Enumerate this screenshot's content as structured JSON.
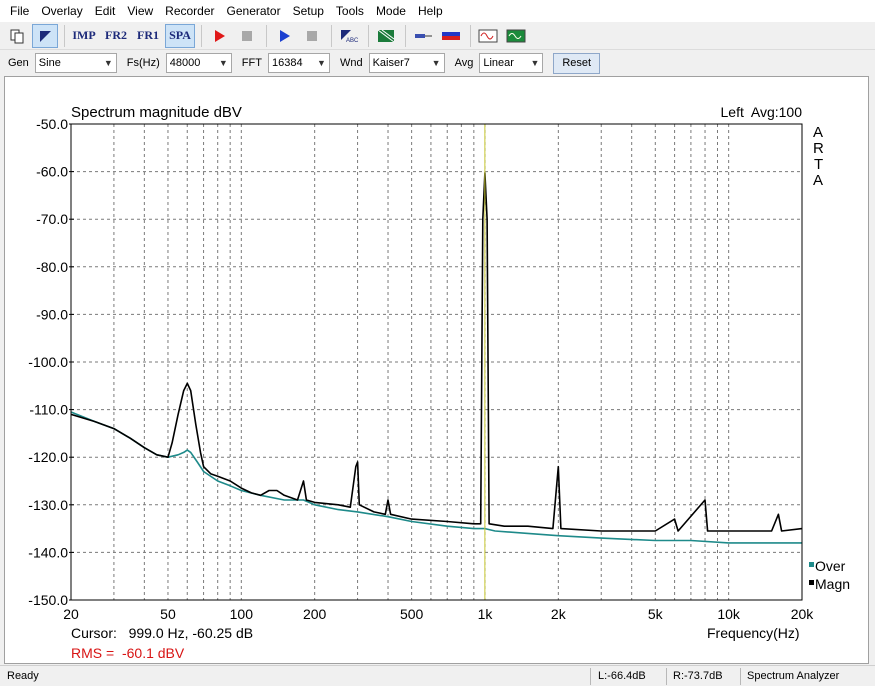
{
  "menu": [
    "File",
    "Overlay",
    "Edit",
    "View",
    "Recorder",
    "Generator",
    "Setup",
    "Tools",
    "Mode",
    "Help"
  ],
  "toolbar": {
    "imp_label": "IMP",
    "fr2_label": "FR2",
    "fr1_label": "FR1",
    "spa_label": "SPA"
  },
  "settings": {
    "gen_label": "Gen",
    "gen_value": "Sine",
    "fs_label": "Fs(Hz)",
    "fs_value": "48000",
    "fft_label": "FFT",
    "fft_value": "16384",
    "wnd_label": "Wnd",
    "wnd_value": "Kaiser7",
    "avg_label": "Avg",
    "avg_value": "Linear",
    "reset_label": "Reset"
  },
  "plot": {
    "channel_info": "Left  Avg:100",
    "arta_letters": [
      "A",
      "R",
      "T",
      "A"
    ],
    "cursor_text": "Cursor:   999.0 Hz, -60.25 dB",
    "rms_text": "RMS =  -60.1 dBV",
    "colors": {
      "magn": "#000000",
      "over": "#1e8a8a",
      "cursor": "#c8c832",
      "rms": "#d81414",
      "grid": "#7a7a7a"
    }
  },
  "chart_data": {
    "type": "line",
    "title": "Spectrum magnitude dBV",
    "xlabel": "Frequency(Hz)",
    "ylabel": "",
    "x_scale": "log",
    "xlim": [
      20,
      20000
    ],
    "ylim": [
      -150,
      -50
    ],
    "grid": true,
    "legend_position": "bottom-right",
    "x_tick_labels": [
      {
        "value": 20,
        "label": "20"
      },
      {
        "value": 50,
        "label": "50"
      },
      {
        "value": 100,
        "label": "100"
      },
      {
        "value": 200,
        "label": "200"
      },
      {
        "value": 500,
        "label": "500"
      },
      {
        "value": 1000,
        "label": "1k"
      },
      {
        "value": 2000,
        "label": "2k"
      },
      {
        "value": 5000,
        "label": "5k"
      },
      {
        "value": 10000,
        "label": "10k"
      },
      {
        "value": 20000,
        "label": "20k"
      }
    ],
    "y_ticks": [
      -50,
      -60,
      -70,
      -80,
      -90,
      -100,
      -110,
      -120,
      -130,
      -140,
      -150
    ],
    "y_tick_labels": [
      "-50.0",
      "-60.0",
      "-70.0",
      "-80.0",
      "-90.0",
      "-100.0",
      "-110.0",
      "-120.0",
      "-130.0",
      "-140.0",
      "-150.0"
    ],
    "cursor_x": 999,
    "series": [
      {
        "name": "Over",
        "color": "#1e8a8a",
        "points": [
          [
            20,
            -110.5
          ],
          [
            25,
            -112.5
          ],
          [
            30,
            -114
          ],
          [
            35,
            -116
          ],
          [
            40,
            -118
          ],
          [
            45,
            -119.5
          ],
          [
            50,
            -120
          ],
          [
            55,
            -119.5
          ],
          [
            58,
            -119
          ],
          [
            60,
            -118.5
          ],
          [
            62,
            -119
          ],
          [
            66,
            -121
          ],
          [
            70,
            -123
          ],
          [
            80,
            -125
          ],
          [
            90,
            -126
          ],
          [
            100,
            -127
          ],
          [
            120,
            -128
          ],
          [
            150,
            -129
          ],
          [
            180,
            -129
          ],
          [
            200,
            -130
          ],
          [
            250,
            -131
          ],
          [
            300,
            -131.5
          ],
          [
            400,
            -132.5
          ],
          [
            500,
            -133.5
          ],
          [
            700,
            -134.5
          ],
          [
            900,
            -135
          ],
          [
            1000,
            -135
          ],
          [
            1100,
            -135.5
          ],
          [
            1500,
            -136
          ],
          [
            2000,
            -136.5
          ],
          [
            3000,
            -137
          ],
          [
            5000,
            -137.5
          ],
          [
            7000,
            -137.5
          ],
          [
            10000,
            -138
          ],
          [
            15000,
            -138
          ],
          [
            20000,
            -138
          ]
        ]
      },
      {
        "name": "Magn",
        "color": "#000000",
        "points": [
          [
            20,
            -111
          ],
          [
            25,
            -112.5
          ],
          [
            30,
            -114
          ],
          [
            35,
            -116
          ],
          [
            40,
            -118
          ],
          [
            45,
            -119.5
          ],
          [
            50,
            -120
          ],
          [
            52,
            -117
          ],
          [
            55,
            -111
          ],
          [
            58,
            -106
          ],
          [
            60,
            -104.5
          ],
          [
            62,
            -106
          ],
          [
            65,
            -113
          ],
          [
            68,
            -119
          ],
          [
            70,
            -122
          ],
          [
            75,
            -123.5
          ],
          [
            80,
            -124
          ],
          [
            90,
            -125
          ],
          [
            100,
            -126.5
          ],
          [
            110,
            -127.5
          ],
          [
            120,
            -128
          ],
          [
            130,
            -127
          ],
          [
            140,
            -127
          ],
          [
            150,
            -128
          ],
          [
            170,
            -129
          ],
          [
            180,
            -125
          ],
          [
            185,
            -129
          ],
          [
            200,
            -129.5
          ],
          [
            250,
            -130
          ],
          [
            280,
            -130.5
          ],
          [
            295,
            -122
          ],
          [
            300,
            -121
          ],
          [
            305,
            -130
          ],
          [
            350,
            -131.5
          ],
          [
            390,
            -132
          ],
          [
            400,
            -129
          ],
          [
            410,
            -132
          ],
          [
            500,
            -133
          ],
          [
            700,
            -133.5
          ],
          [
            900,
            -134
          ],
          [
            960,
            -134
          ],
          [
            980,
            -70
          ],
          [
            999,
            -60.25
          ],
          [
            1020,
            -70
          ],
          [
            1040,
            -134
          ],
          [
            1200,
            -134.5
          ],
          [
            1500,
            -134.5
          ],
          [
            1900,
            -135
          ],
          [
            2000,
            -122
          ],
          [
            2050,
            -135
          ],
          [
            3000,
            -135.5
          ],
          [
            5000,
            -135.5
          ],
          [
            6000,
            -133
          ],
          [
            6200,
            -135.5
          ],
          [
            8000,
            -129
          ],
          [
            8200,
            -135.5
          ],
          [
            10000,
            -135.5
          ],
          [
            15000,
            -135.5
          ],
          [
            16000,
            -132
          ],
          [
            16500,
            -135.5
          ],
          [
            20000,
            -135
          ]
        ]
      }
    ]
  },
  "status": {
    "ready": "Ready",
    "left_level": "L:-66.4dB",
    "right_level": "R:-73.7dB",
    "mode": "Spectrum Analyzer"
  }
}
